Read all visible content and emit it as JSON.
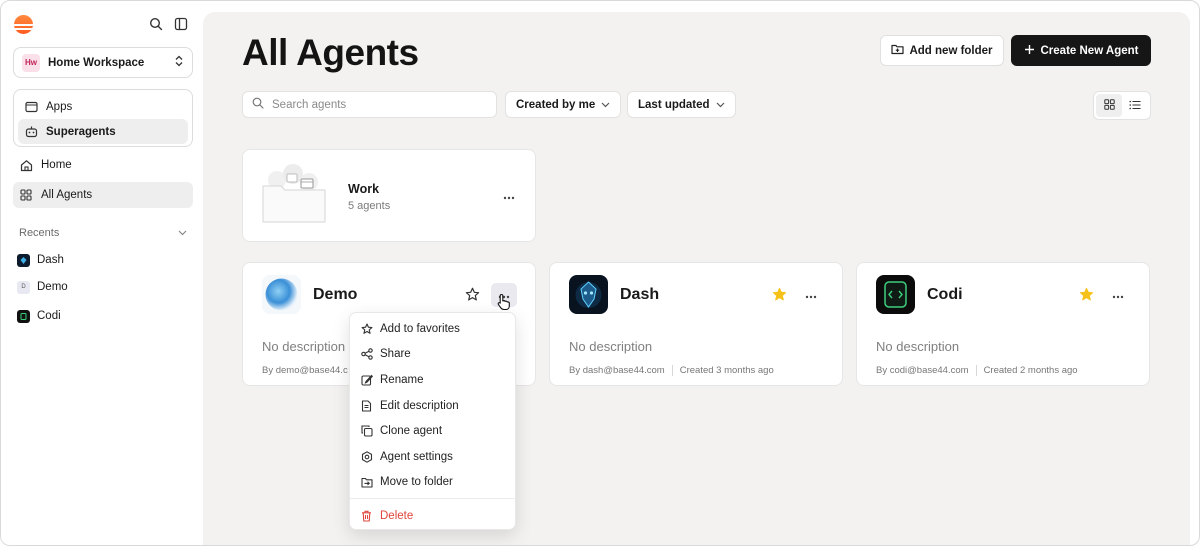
{
  "sidebar": {
    "workspace": {
      "badge": "Hw",
      "name": "Home Workspace"
    },
    "group_items": [
      {
        "label": "Apps",
        "icon": "window-icon"
      },
      {
        "label": "Superagents",
        "icon": "robot-icon",
        "active": true
      }
    ],
    "home_label": "Home",
    "all_agents_label": "All Agents",
    "recents_label": "Recents",
    "recents": [
      {
        "label": "Dash",
        "avatar": ""
      },
      {
        "label": "Demo",
        "avatar": "D"
      },
      {
        "label": "Codi",
        "avatar": ""
      }
    ]
  },
  "main": {
    "title": "All Agents",
    "add_folder_label": "Add new folder",
    "create_agent_label": "Create New Agent",
    "search_placeholder": "Search agents",
    "filter_created": "Created by me",
    "filter_sort": "Last updated",
    "folder": {
      "name": "Work",
      "count": "5 agents"
    },
    "agents": [
      {
        "name": "Demo",
        "description": "No description",
        "author": "By demo@base44.c",
        "created": "",
        "favorite": false
      },
      {
        "name": "Dash",
        "description": "No description",
        "author": "By dash@base44.com",
        "created": "Created 3 months ago",
        "favorite": true
      },
      {
        "name": "Codi",
        "description": "No description",
        "author": "By codi@base44.com",
        "created": "Created 2 months ago",
        "favorite": true
      }
    ]
  },
  "context_menu": {
    "items": [
      {
        "label": "Add to favorites",
        "icon": "star-icon"
      },
      {
        "label": "Share",
        "icon": "share-icon"
      },
      {
        "label": "Rename",
        "icon": "edit-icon"
      },
      {
        "label": "Edit description",
        "icon": "document-icon"
      },
      {
        "label": "Clone agent",
        "icon": "copy-icon"
      },
      {
        "label": "Agent settings",
        "icon": "gear-icon"
      },
      {
        "label": "Move to folder",
        "icon": "folder-move-icon"
      }
    ],
    "delete_label": "Delete"
  },
  "colors": {
    "accent_dark": "#161616",
    "star_yellow": "#f6c21a",
    "danger": "#e0443a",
    "main_bg": "#f3f2f0"
  }
}
